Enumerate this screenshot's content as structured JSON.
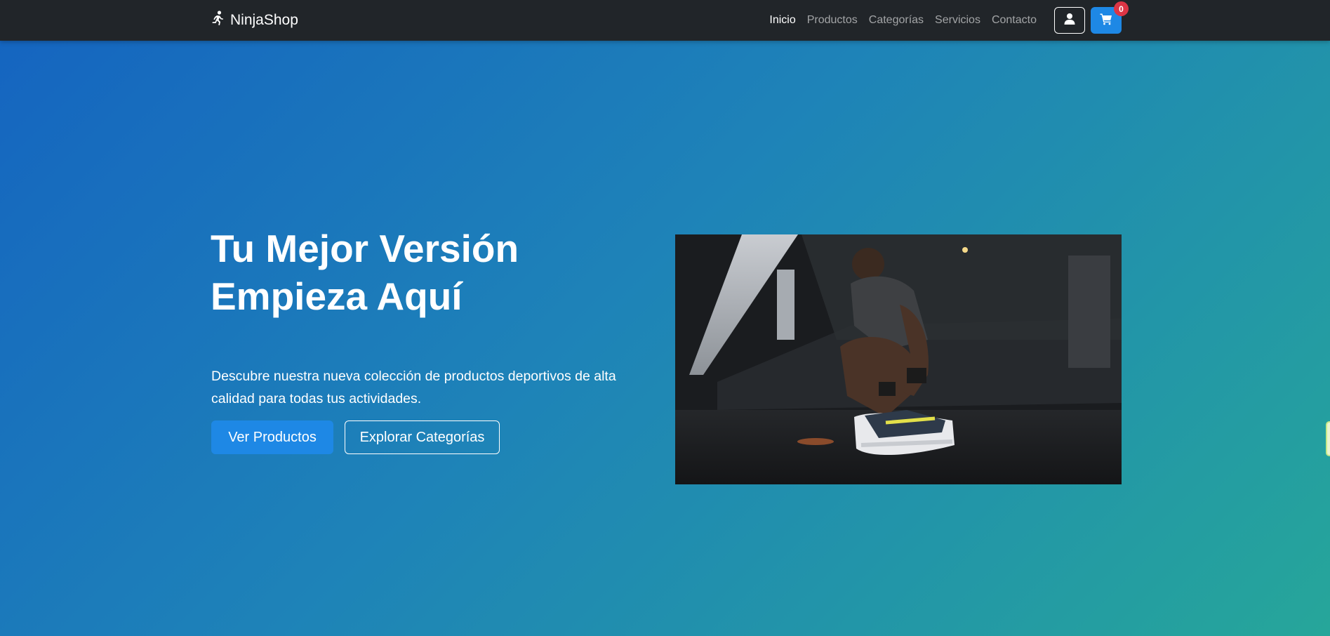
{
  "brand": {
    "name": "NinjaShop",
    "icon": "running-person-icon"
  },
  "nav": {
    "items": [
      {
        "label": "Inicio",
        "active": true
      },
      {
        "label": "Productos",
        "active": false
      },
      {
        "label": "Categorías",
        "active": false
      },
      {
        "label": "Servicios",
        "active": false
      },
      {
        "label": "Contacto",
        "active": false
      }
    ],
    "user_icon": "user-icon",
    "cart_icon": "shopping-cart-icon",
    "cart_count": "0"
  },
  "hero": {
    "title_line1": "Tu Mejor Versión",
    "title_line2": "Empieza Aquí",
    "subtitle": "Descubre nuestra nueva colección de productos deportivos de alta calidad para todas tus actividades.",
    "primary_button": "Ver Productos",
    "secondary_button": "Explorar Categorías"
  },
  "colors": {
    "navbar": "#212529",
    "accent": "#1e88e5",
    "badge": "#dc3545",
    "gradient_start": "#1565c0",
    "gradient_end": "#26a69a"
  }
}
